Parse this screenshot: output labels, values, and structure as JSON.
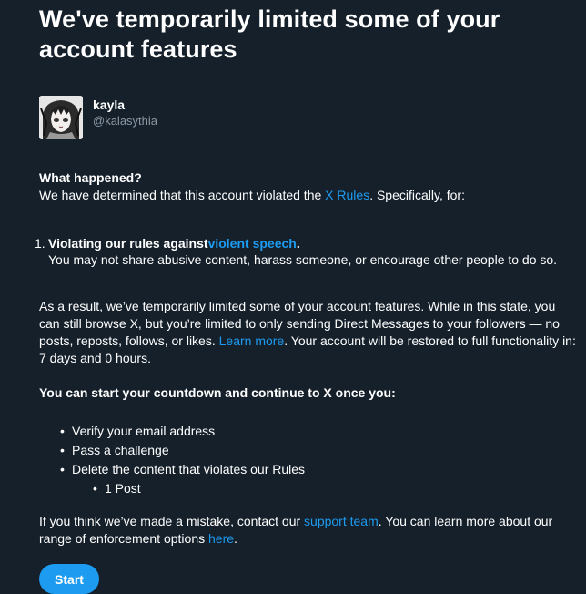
{
  "title": "We've temporarily limited some of your account features",
  "user": {
    "display_name": "kayla",
    "handle": "@kalasythia"
  },
  "what_happened": {
    "heading": "What happened?",
    "text_before": "We have determined that this account violated the ",
    "rules_link": "X Rules",
    "text_after": ". Specifically, for:"
  },
  "violations": [
    {
      "number": "1.",
      "title_before": "Violating our rules against ",
      "title_link": "violent speech",
      "title_after": ".",
      "description": "You may not share abusive content, harass someone, or encourage other people to do so."
    }
  ],
  "result": {
    "text_before": "As a result, we’ve temporarily limited some of your account features. While in this state, you can still browse X, but you’re limited to only sending Direct Messages to your followers — no posts, reposts, follows, or likes. ",
    "learn_more_link": "Learn more",
    "text_after": ". Your account will be restored to full functionality in: 7 days and 0 hours."
  },
  "countdown": {
    "heading": "You can start your countdown and continue to X once you:",
    "steps": [
      "Verify your email address",
      "Pass a challenge",
      "Delete the content that violates our Rules"
    ],
    "sub_steps": [
      "1 Post"
    ]
  },
  "mistake": {
    "text_before": "If you think we’ve made a mistake, contact our ",
    "support_link": "support team",
    "text_middle": ". You can learn more about our range of enforcement options ",
    "here_link": "here",
    "text_after": "."
  },
  "start_button": "Start",
  "colors": {
    "background": "#15202b",
    "accent": "#1d9bf0",
    "muted": "#8b98a5"
  }
}
